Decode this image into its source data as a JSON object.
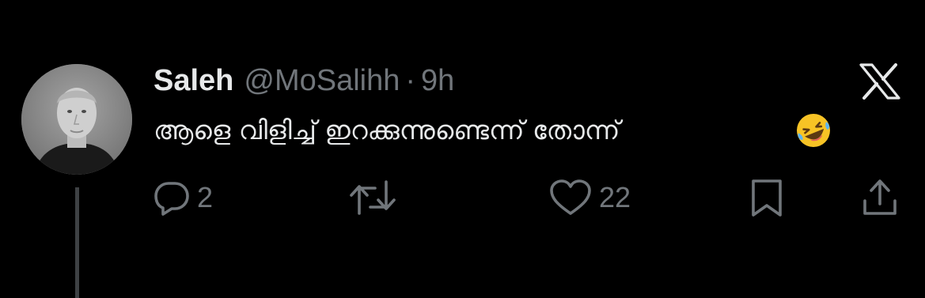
{
  "tweet": {
    "display_name": "Saleh",
    "handle": "@MoSalihh",
    "separator": "·",
    "time": "9h",
    "text": "ആളെ വിളിച്ച് ഇറക്കുന്നുണ്ടെന്ന് തോന്ന്",
    "emoji": "rolling-on-the-floor-laughing-emoji"
  },
  "actions": {
    "reply_count": "2",
    "retweet_count": "",
    "like_count": "22"
  },
  "icons": {
    "reply": "speech-bubble-icon",
    "retweet": "retweet-icon",
    "like": "heart-icon",
    "bookmark": "bookmark-icon",
    "share": "share-icon",
    "brand": "x-logo"
  },
  "colors": {
    "background": "#000000",
    "primary_text": "#e7e9ea",
    "secondary_text": "#71767b",
    "thread_line": "#3e4144"
  }
}
